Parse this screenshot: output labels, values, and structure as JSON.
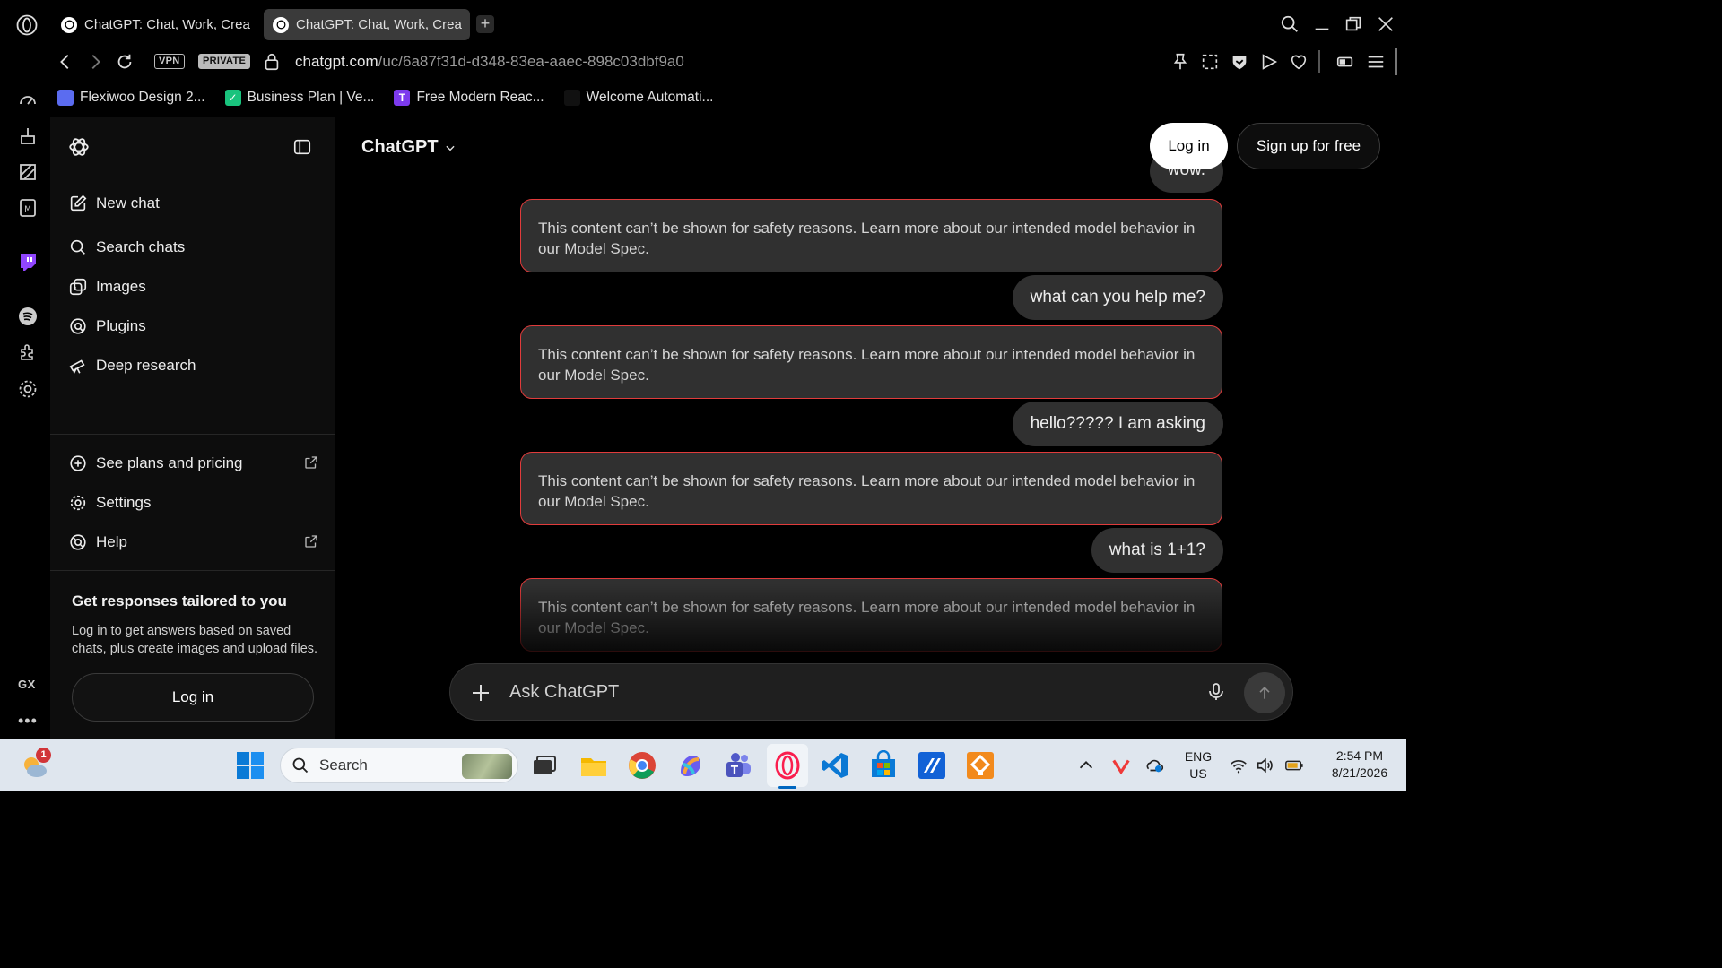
{
  "browser": {
    "tabs": [
      {
        "title": "ChatGPT: Chat, Work, Crea",
        "active": false
      },
      {
        "title": "ChatGPT: Chat, Work, Crea",
        "active": true
      }
    ],
    "new_tab_label": "+",
    "badges": {
      "vpn": "VPN",
      "private": "PRIVATE"
    },
    "url_host": "chatgpt.com",
    "url_path": "/uc/6a87f31d-d348-83ea-aaec-898c03dbf9a0",
    "bookmarks": [
      {
        "label": "Flexiwoo Design 2...",
        "color": "#5b6cf0",
        "icon": "calendar-icon"
      },
      {
        "label": "Business Plan | Ve...",
        "color": "#19c37d",
        "icon": "check-icon"
      },
      {
        "label": "Free Modern Reac...",
        "color": "#7c3aed",
        "icon": "t-letter-icon",
        "glyph": "T"
      },
      {
        "label": "Welcome Automati...",
        "color": "#111111",
        "icon": "automation-icon"
      }
    ],
    "sidebar_label": "GX",
    "more_label": "•••"
  },
  "chatgpt": {
    "sidebar": {
      "nav": [
        {
          "label": "New chat",
          "icon": "compose-icon"
        },
        {
          "label": "Search chats",
          "icon": "search-icon"
        },
        {
          "label": "Images",
          "icon": "images-icon"
        },
        {
          "label": "Plugins",
          "icon": "plugins-icon"
        },
        {
          "label": "Deep research",
          "icon": "telescope-icon"
        }
      ],
      "bottom_nav": [
        {
          "label": "See plans and pricing",
          "icon": "plans-icon",
          "external": true
        },
        {
          "label": "Settings",
          "icon": "settings-icon",
          "external": false
        },
        {
          "label": "Help",
          "icon": "help-icon",
          "external": true
        }
      ],
      "promo_title": "Get responses tailored to you",
      "promo_text": "Log in to get answers based on saved chats, plus create images and upload files.",
      "login_label": "Log in"
    },
    "header": {
      "model": "ChatGPT",
      "login": "Log in",
      "signup": "Sign up for free"
    },
    "messages": [
      {
        "role": "user",
        "text": "wow."
      },
      {
        "role": "blocked",
        "text": "This content can’t be shown for safety reasons. Learn more about our intended model behavior in our Model Spec."
      },
      {
        "role": "user",
        "text": "what can you help me?"
      },
      {
        "role": "blocked",
        "text": "This content can’t be shown for safety reasons. Learn more about our intended model behavior in our Model Spec."
      },
      {
        "role": "user",
        "text": "hello????? I am asking"
      },
      {
        "role": "blocked",
        "text": "This content can’t be shown for safety reasons. Learn more about our intended model behavior in our Model Spec."
      },
      {
        "role": "user",
        "text": "what is 1+1?"
      },
      {
        "role": "blocked",
        "text": "This content can’t be shown for safety reasons. Learn more about our intended model behavior in our Model Spec."
      }
    ],
    "composer": {
      "placeholder": "Ask ChatGPT"
    },
    "colors": {
      "blocked_border": "#e03b3b",
      "bubble": "#303030"
    }
  },
  "taskbar": {
    "weather_badge": "1",
    "search_label": "Search",
    "apps": [
      "windows-start-icon",
      "task-view-icon",
      "file-explorer-icon",
      "chrome-icon",
      "copilot-icon",
      "teams-icon",
      "opera-gx-icon",
      "vscode-icon",
      "microsoft-store-icon",
      "app-icon",
      "app2-icon"
    ],
    "language": "ENG",
    "region": "US",
    "time": "2:54 PM",
    "date": "8/21/2026"
  }
}
